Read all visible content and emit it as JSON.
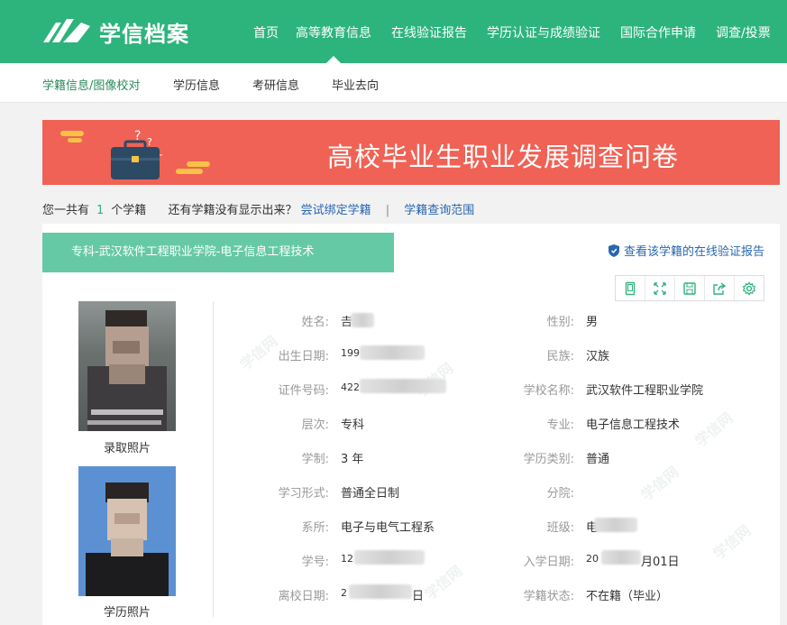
{
  "header": {
    "logo_text": "学信档案",
    "nav": [
      "首页",
      "高等教育信息",
      "在线验证报告",
      "学历认证与成绩验证",
      "国际合作申请",
      "调查/投票"
    ],
    "active_nav": "高等教育信息"
  },
  "subnav": {
    "items": [
      "学籍信息/图像校对",
      "学历信息",
      "考研信息",
      "毕业去向"
    ],
    "active": "学籍信息/图像校对"
  },
  "banner": {
    "title": "高校毕业生职业发展调查问卷"
  },
  "summary": {
    "prefix": "您一共有",
    "count": "1",
    "suffix": "个学籍",
    "question": "还有学籍没有显示出来？",
    "bind_link": "尝试绑定学籍",
    "separator": "|",
    "scope_link": "学籍查询范围"
  },
  "record": {
    "tab_title": "专科-武汉软件工程职业学院-电子信息工程技术",
    "verify_link": "查看该学籍的在线验证报告",
    "toolbar_icons": [
      "tablet-icon",
      "expand-icon",
      "save-icon",
      "share-icon",
      "settings-icon"
    ],
    "admission_photo_caption": "录取照片",
    "diploma_photo_caption": "学历照片",
    "fields": [
      {
        "label": "姓名:",
        "value": "𠮷",
        "redacted": true
      },
      {
        "label": "性别:",
        "value": "男"
      },
      {
        "label": "出生日期:",
        "value": "199",
        "redacted": true
      },
      {
        "label": "民族:",
        "value": "汉族"
      },
      {
        "label": "证件号码:",
        "value": "422",
        "redacted": true
      },
      {
        "label": "学校名称:",
        "value": "武汉软件工程职业学院"
      },
      {
        "label": "层次:",
        "value": "专科"
      },
      {
        "label": "专业:",
        "value": "电子信息工程技术"
      },
      {
        "label": "学制:",
        "value": "3 年"
      },
      {
        "label": "学历类别:",
        "value": "普通"
      },
      {
        "label": "学习形式:",
        "value": "普通全日制"
      },
      {
        "label": "分院:",
        "value": ""
      },
      {
        "label": "系所:",
        "value": "电子与电气工程系"
      },
      {
        "label": "班级:",
        "value": "电",
        "redacted": true
      },
      {
        "label": "学号:",
        "value": "12",
        "redacted": true
      },
      {
        "label": "入学日期:",
        "value": "20",
        "suffix": "月01日",
        "redacted": true
      },
      {
        "label": "离校日期:",
        "value": "2",
        "suffix": "日",
        "redacted": true
      },
      {
        "label": "学籍状态:",
        "value": "不在籍（毕业）"
      }
    ],
    "watermark": "学信网"
  },
  "colors": {
    "brand": "#2db47d",
    "tab": "#66c9a5",
    "banner": "#ef6255",
    "link": "#2a66b0"
  }
}
